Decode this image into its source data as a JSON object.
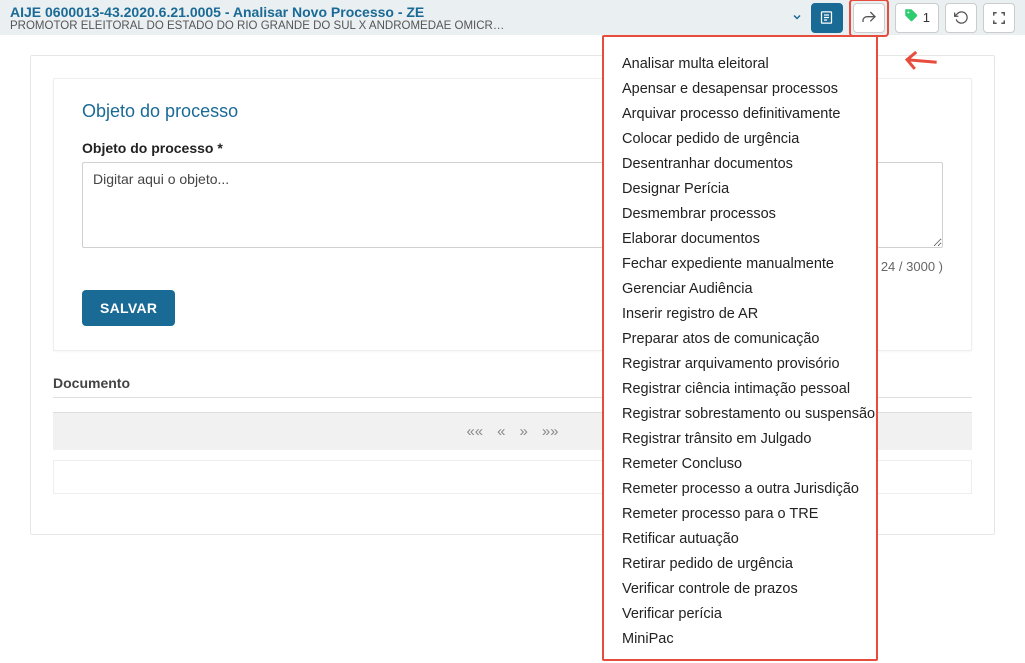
{
  "header": {
    "title": "AIJE 0600013-43.2020.6.21.0005 - Analisar Novo Processo - ZE",
    "subtitle": "PROMOTOR ELEITORAL DO ESTADO DO RIO GRANDE DO SUL X ANDROMEDAE OMICR…",
    "tag_count": "1"
  },
  "card": {
    "title": "Objeto do processo",
    "field_label": "Objeto do processo *",
    "textarea_value": "Digitar aqui o objeto...",
    "char_count": "( 24 / 3000 )",
    "save_label": "SALVAR"
  },
  "doc_section": {
    "label": "Documento"
  },
  "pager": {
    "first": "««",
    "prev": "«",
    "next": "»",
    "last": "»»"
  },
  "menu_items": [
    "Analisar multa eleitoral",
    "Apensar e desapensar processos",
    "Arquivar processo definitivamente",
    "Colocar pedido de urgência",
    "Desentranhar documentos",
    "Designar Perícia",
    "Desmembrar processos",
    "Elaborar documentos",
    "Fechar expediente manualmente",
    "Gerenciar Audiência",
    "Inserir registro de AR",
    "Preparar atos de comunicação",
    "Registrar arquivamento provisório",
    "Registrar ciência intimação pessoal",
    "Registrar sobrestamento ou suspensão",
    "Registrar trânsito em Julgado",
    "Remeter Concluso",
    "Remeter processo a outra Jurisdição",
    "Remeter processo para o TRE",
    "Retificar autuação",
    "Retirar pedido de urgência",
    "Verificar controle de prazos",
    "Verificar perícia",
    "MiniPac"
  ]
}
